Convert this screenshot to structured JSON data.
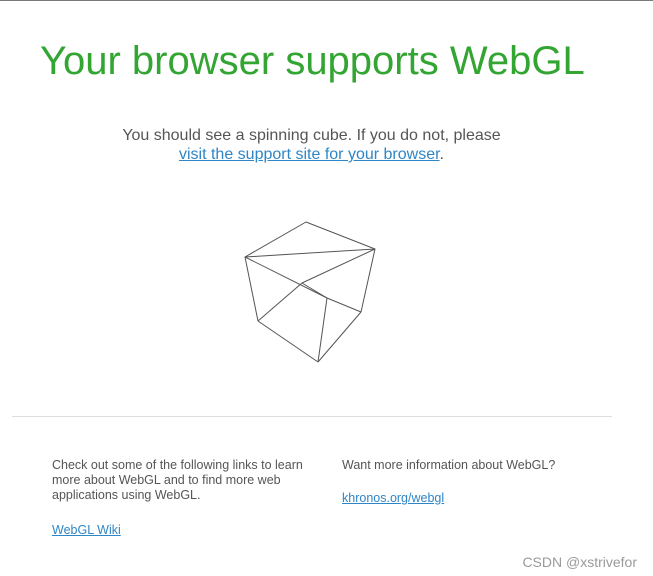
{
  "headline": "Your browser supports WebGL",
  "intro": {
    "text": "You should see a spinning cube. If you do not, please",
    "link": "visit the support site for your browser",
    "after": "."
  },
  "left_column": {
    "text": "Check out some of the following links to learn more about WebGL and to find more web applications using WebGL.",
    "link": "WebGL Wiki"
  },
  "right_column": {
    "text": "Want more information about WebGL?",
    "link": "khronos.org/webgl"
  },
  "watermark": "CSDN @xstrivefor",
  "colors": {
    "headline": "#33a532",
    "link": "#2f86c6",
    "text": "#555555"
  }
}
